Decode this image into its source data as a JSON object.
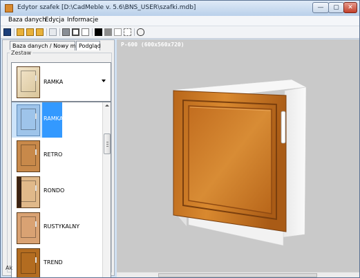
{
  "window": {
    "title": "Edytor szafek [D:\\CadMeble v. 5.6\\BNS_USER\\szafki.mdb]",
    "minimize": "—",
    "maximize": "▢",
    "close": "✕"
  },
  "menu": {
    "items": [
      "Baza danych",
      "Edycja",
      "Informacje"
    ]
  },
  "toolbar": {
    "icons": [
      "save-icon",
      "open-folder-icon",
      "browse-icon",
      "export-icon",
      "undo-icon",
      "copy-icon",
      "duplicate-icon",
      "page-icon",
      "fill-black-icon",
      "fill-gray-icon",
      "fill-white-icon",
      "outline-icon",
      "link-icon"
    ]
  },
  "tabs": {
    "database": "Baza danych / Nowy model",
    "preview": "Podgląd"
  },
  "group": {
    "label": "Zestaw"
  },
  "combo": {
    "selected": "RAMKA"
  },
  "dropdown": {
    "options": [
      {
        "label": "RAMKA",
        "selected": true,
        "color": "#9ec4ea"
      },
      {
        "label": "RETRO",
        "selected": false,
        "color": "#c8894a"
      },
      {
        "label": "RONDO",
        "selected": false,
        "color": "#6b4228"
      },
      {
        "label": "RUSTYKALNY",
        "selected": false,
        "color": "#d9a273"
      },
      {
        "label": "TREND",
        "selected": false,
        "color": "#b36c20"
      }
    ]
  },
  "status": {
    "fragment": "Ak"
  },
  "viewport": {
    "label": "P-600 (600x560x720)"
  },
  "colors": {
    "wood": "#c4741f",
    "wood_dark": "#7a3f0e",
    "carcass": "#f4f4f4",
    "selection": "#3399ff"
  }
}
